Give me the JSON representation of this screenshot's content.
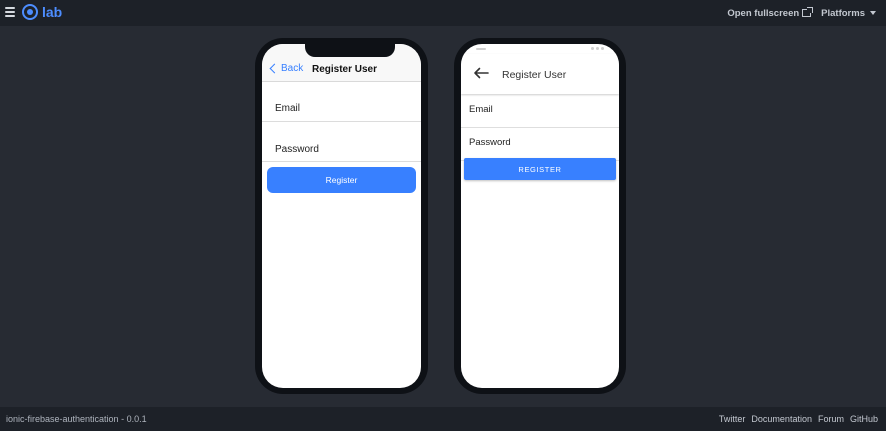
{
  "topbar": {
    "logo_text": "lab",
    "open_fullscreen": "Open fullscreen",
    "platforms": "Platforms"
  },
  "ios": {
    "back_label": "Back",
    "title": "Register User",
    "email_label": "Email",
    "password_label": "Password",
    "register_button": "Register"
  },
  "android": {
    "title": "Register User",
    "email_label": "Email",
    "password_label": "Password",
    "register_button": "REGISTER"
  },
  "footer": {
    "app_name": "ionic-firebase-authentication - 0.0.1",
    "links": [
      "Twitter",
      "Documentation",
      "Forum",
      "GitHub"
    ]
  },
  "colors": {
    "accent": "#3880ff",
    "brand": "#4d8dff",
    "background": "#272b33",
    "bar": "#1d2128"
  }
}
